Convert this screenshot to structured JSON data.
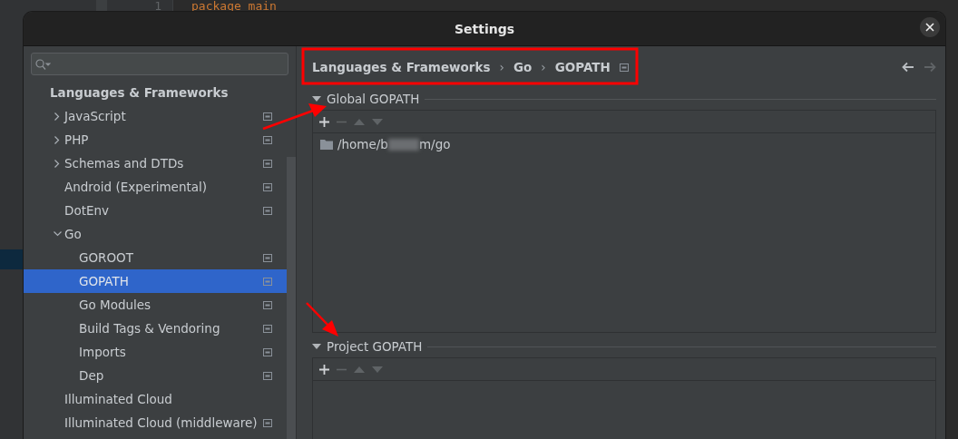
{
  "editor": {
    "line_number": "1",
    "code": "package main"
  },
  "window": {
    "title": "Settings"
  },
  "sidebar": {
    "items": [
      {
        "label": "Languages & Frameworks",
        "kind": "header",
        "children": [
          {
            "label": "JavaScript",
            "expanded": false,
            "project_level": true,
            "selected": false
          },
          {
            "label": "PHP",
            "expanded": false,
            "project_level": true,
            "selected": false
          },
          {
            "label": "Schemas and DTDs",
            "expanded": false,
            "project_level": true,
            "selected": false
          },
          {
            "label": "Android (Experimental)",
            "project_level": true,
            "selected": false
          },
          {
            "label": "DotEnv",
            "project_level": true,
            "selected": false
          },
          {
            "label": "Go",
            "expanded": true,
            "project_level": false,
            "selected": false,
            "children": [
              {
                "label": "GOROOT",
                "project_level": true,
                "selected": false
              },
              {
                "label": "GOPATH",
                "project_level": true,
                "selected": true
              },
              {
                "label": "Go Modules",
                "project_level": true,
                "selected": false
              },
              {
                "label": "Build Tags & Vendoring",
                "project_level": true,
                "selected": false
              },
              {
                "label": "Imports",
                "project_level": true,
                "selected": false
              },
              {
                "label": "Dep",
                "project_level": true,
                "selected": false
              }
            ]
          },
          {
            "label": "Illuminated Cloud",
            "project_level": false,
            "selected": false
          },
          {
            "label": "Illuminated Cloud (middleware)",
            "project_level": true,
            "selected": false
          }
        ]
      }
    ]
  },
  "breadcrumb": {
    "parts": [
      "Languages & Frameworks",
      "›",
      "Go",
      "›",
      "GOPATH"
    ],
    "project_level": true
  },
  "navigation": {
    "back_disabled": false,
    "forward_disabled": true
  },
  "sections": [
    {
      "title": "Global GOPATH",
      "expanded": true,
      "paths": [
        {
          "start": "/home/b",
          "end": "m/go",
          "blurred": true
        }
      ]
    },
    {
      "title": "Project GOPATH",
      "expanded": true
    }
  ]
}
